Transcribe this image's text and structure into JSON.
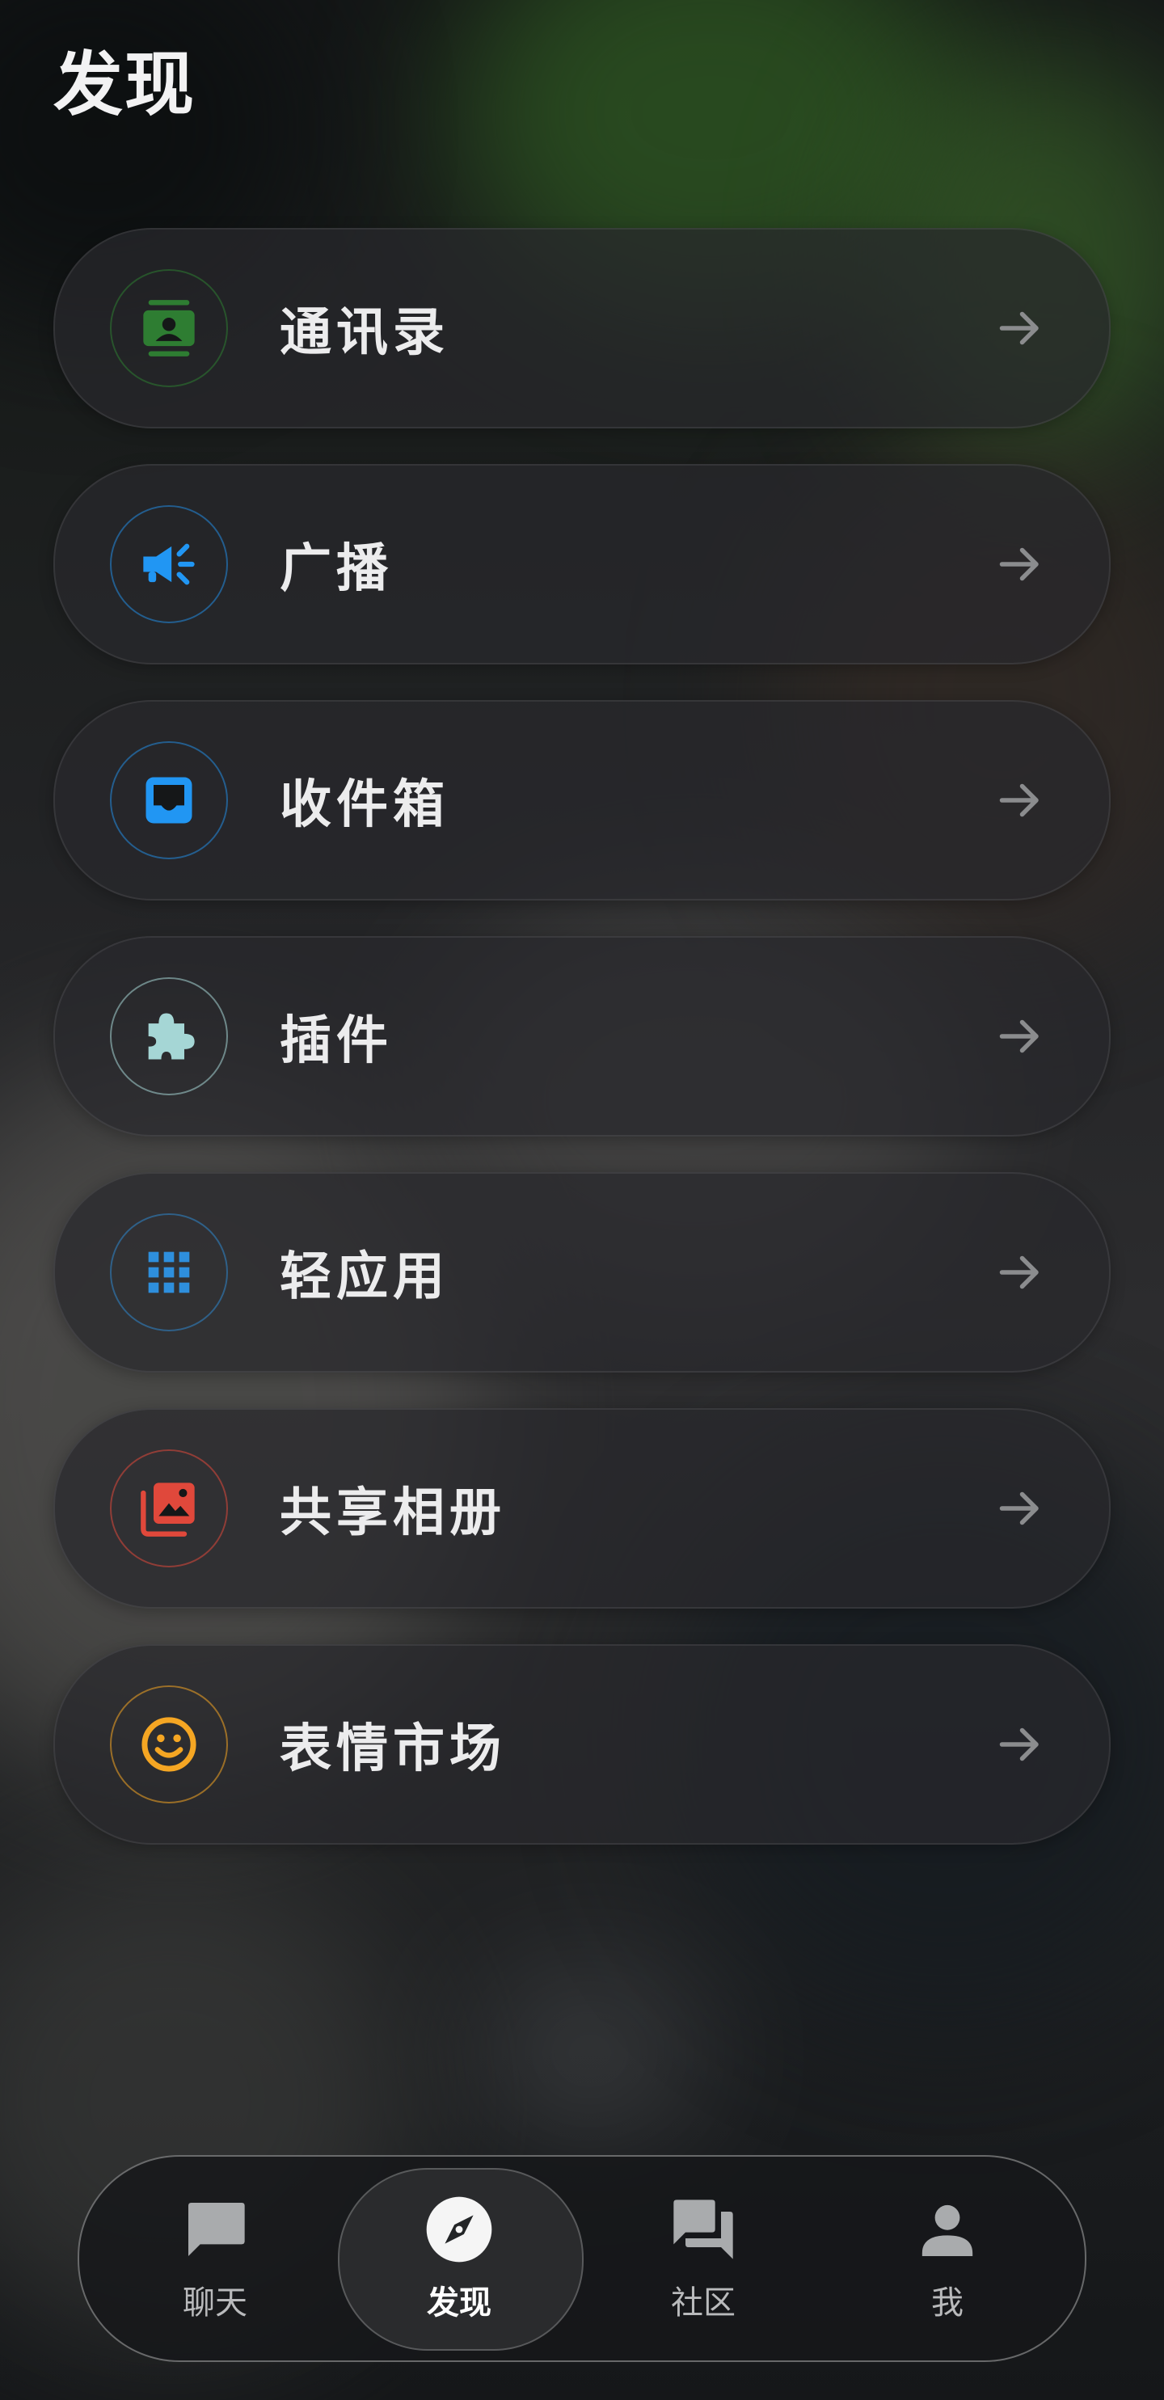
{
  "page": {
    "title": "发现"
  },
  "menu": {
    "items": [
      {
        "label": "通讯录",
        "icon": "contacts-icon",
        "color": "#2e7d32"
      },
      {
        "label": "广播",
        "icon": "megaphone-icon",
        "color": "#2196f3"
      },
      {
        "label": "收件箱",
        "icon": "inbox-icon",
        "color": "#2196f3"
      },
      {
        "label": "插件",
        "icon": "puzzle-icon",
        "color": "#a5d6d5"
      },
      {
        "label": "轻应用",
        "icon": "apps-grid-icon",
        "color": "#2e8fdd"
      },
      {
        "label": "共享相册",
        "icon": "photo-library-icon",
        "color": "#e0483b"
      },
      {
        "label": "表情市场",
        "icon": "emoji-icon",
        "color": "#f5a623"
      }
    ]
  },
  "tabbar": {
    "tabs": [
      {
        "label": "聊天",
        "icon": "chat-bubble-icon",
        "active": false
      },
      {
        "label": "发现",
        "icon": "compass-icon",
        "active": true
      },
      {
        "label": "社区",
        "icon": "forum-icon",
        "active": false
      },
      {
        "label": "我",
        "icon": "person-icon",
        "active": false
      }
    ]
  }
}
